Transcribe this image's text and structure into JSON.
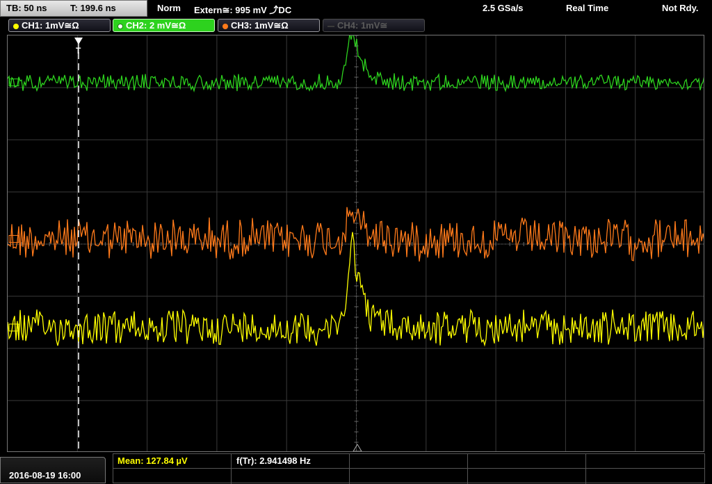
{
  "topbar": {
    "timebase": "TB: 50 ns",
    "trigger_time": "T: 199.6 ns",
    "mode": "Norm",
    "trigger_source": "Extern≅: 995 mV ⤴DC",
    "sample_rate": "2.5 GSa/s",
    "acquisition": "Real Time",
    "status": "Not Rdy."
  },
  "channels": [
    {
      "label": "CH1: 1mV≅Ω",
      "color": "#ffff00",
      "state": "normal"
    },
    {
      "label": "CH2: 2 mV≅Ω",
      "color": "#2dd21e",
      "state": "active"
    },
    {
      "label": "CH3: 1mV≅Ω",
      "color": "#ff7a1a",
      "state": "normal"
    },
    {
      "label": "CH4: 1mV≅",
      "color": "#5a5a5a",
      "state": "disabled"
    }
  ],
  "trigger_marker": "T",
  "measurements": {
    "mean": "Mean: 127.84 µV",
    "frequency": "f(Tr): 2.941498 Hz"
  },
  "datetime": "2016-08-19 16:00",
  "waveforms": {
    "ch2": {
      "color": "#2dd21e",
      "baseline_div": 0.9,
      "noise_div": 0.18,
      "pulse_div": 1.0
    },
    "ch3": {
      "color": "#ff7a1a",
      "baseline_div": 3.9,
      "noise_div": 0.45,
      "pulse_div": -0.6
    },
    "ch1": {
      "color": "#ffff00",
      "baseline_div": 5.6,
      "noise_div": 0.38,
      "pulse_div": -1.8
    }
  }
}
